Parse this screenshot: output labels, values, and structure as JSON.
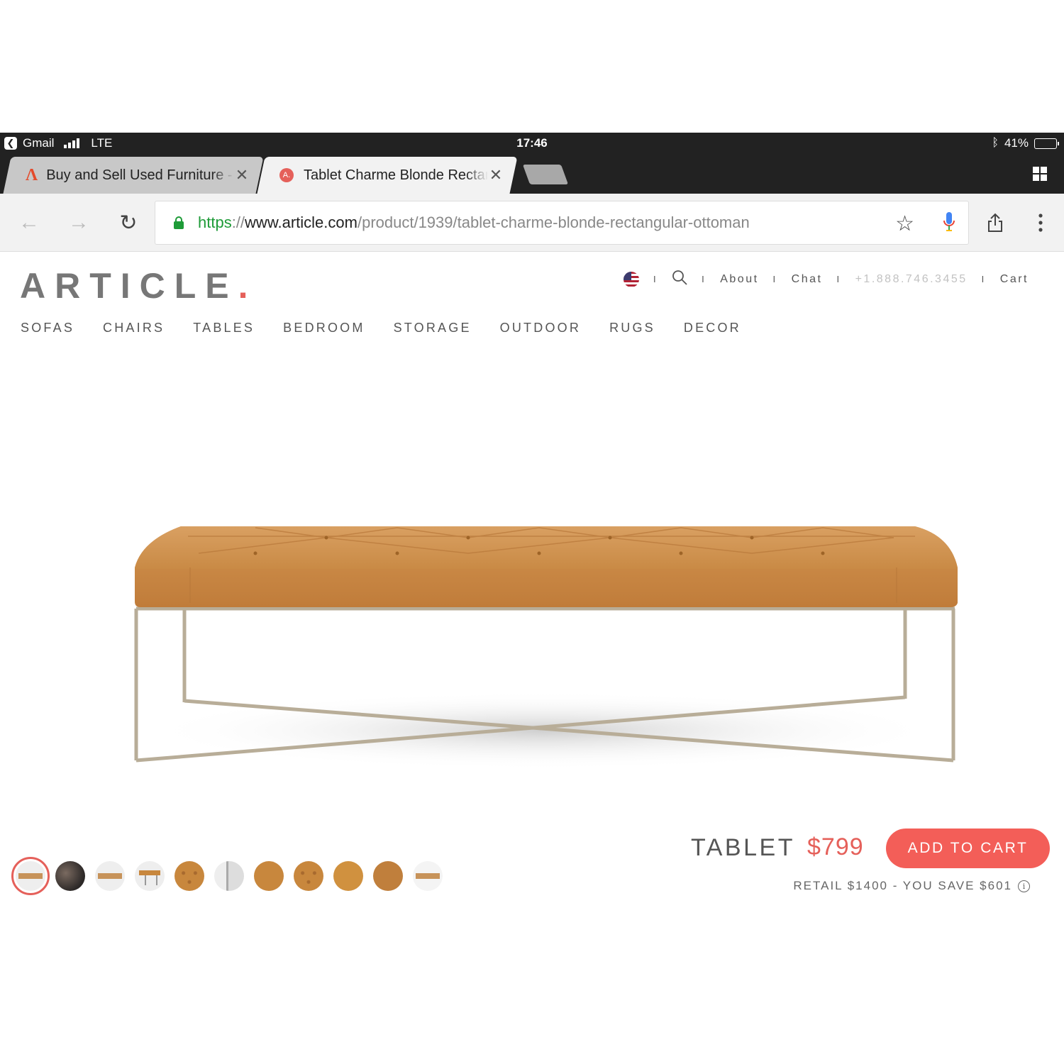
{
  "status_bar": {
    "back_app": "Gmail",
    "network": "LTE",
    "time": "17:46",
    "battery": "41%",
    "battery_level": 0.41
  },
  "tabs": [
    {
      "title": "Buy and Sell Used Furniture -",
      "favicon": "aptdeco-a-icon",
      "active": false
    },
    {
      "title": "Tablet Charme Blonde Rectangular Ottoman",
      "favicon": "article-favicon",
      "active": true
    }
  ],
  "toolbar": {
    "url_scheme": "https",
    "url_sep": "://",
    "url_host": "www.article.com",
    "url_path": "/product/1939/tablet-charme-blonde-rectangular-ottoman"
  },
  "site": {
    "logo": "ARTICLE",
    "logo_dot": ".",
    "utility_nav": [
      "About",
      "Chat",
      "+1.888.746.3455",
      "Cart"
    ],
    "main_nav": [
      "SOFAS",
      "CHAIRS",
      "TABLES",
      "BEDROOM",
      "STORAGE",
      "OUTDOOR",
      "RUGS",
      "DECOR"
    ]
  },
  "product": {
    "name": "TABLET",
    "price": "$799",
    "add_to_cart": "ADD TO CART",
    "savings": "RETAIL $1400 - YOU SAVE $601",
    "thumbnails": [
      "front-white",
      "lifestyle-dark",
      "side-white",
      "angle-white",
      "tufting-detail",
      "leg-detail",
      "leather-swatch",
      "button-detail",
      "stitch-detail",
      "leather-closeup",
      "profile-white"
    ],
    "selected_thumbnail": 0
  },
  "colors": {
    "accent": "#f35e58",
    "price": "#e5605a",
    "leather": "#c8873d",
    "frame": "#b8ad98"
  }
}
